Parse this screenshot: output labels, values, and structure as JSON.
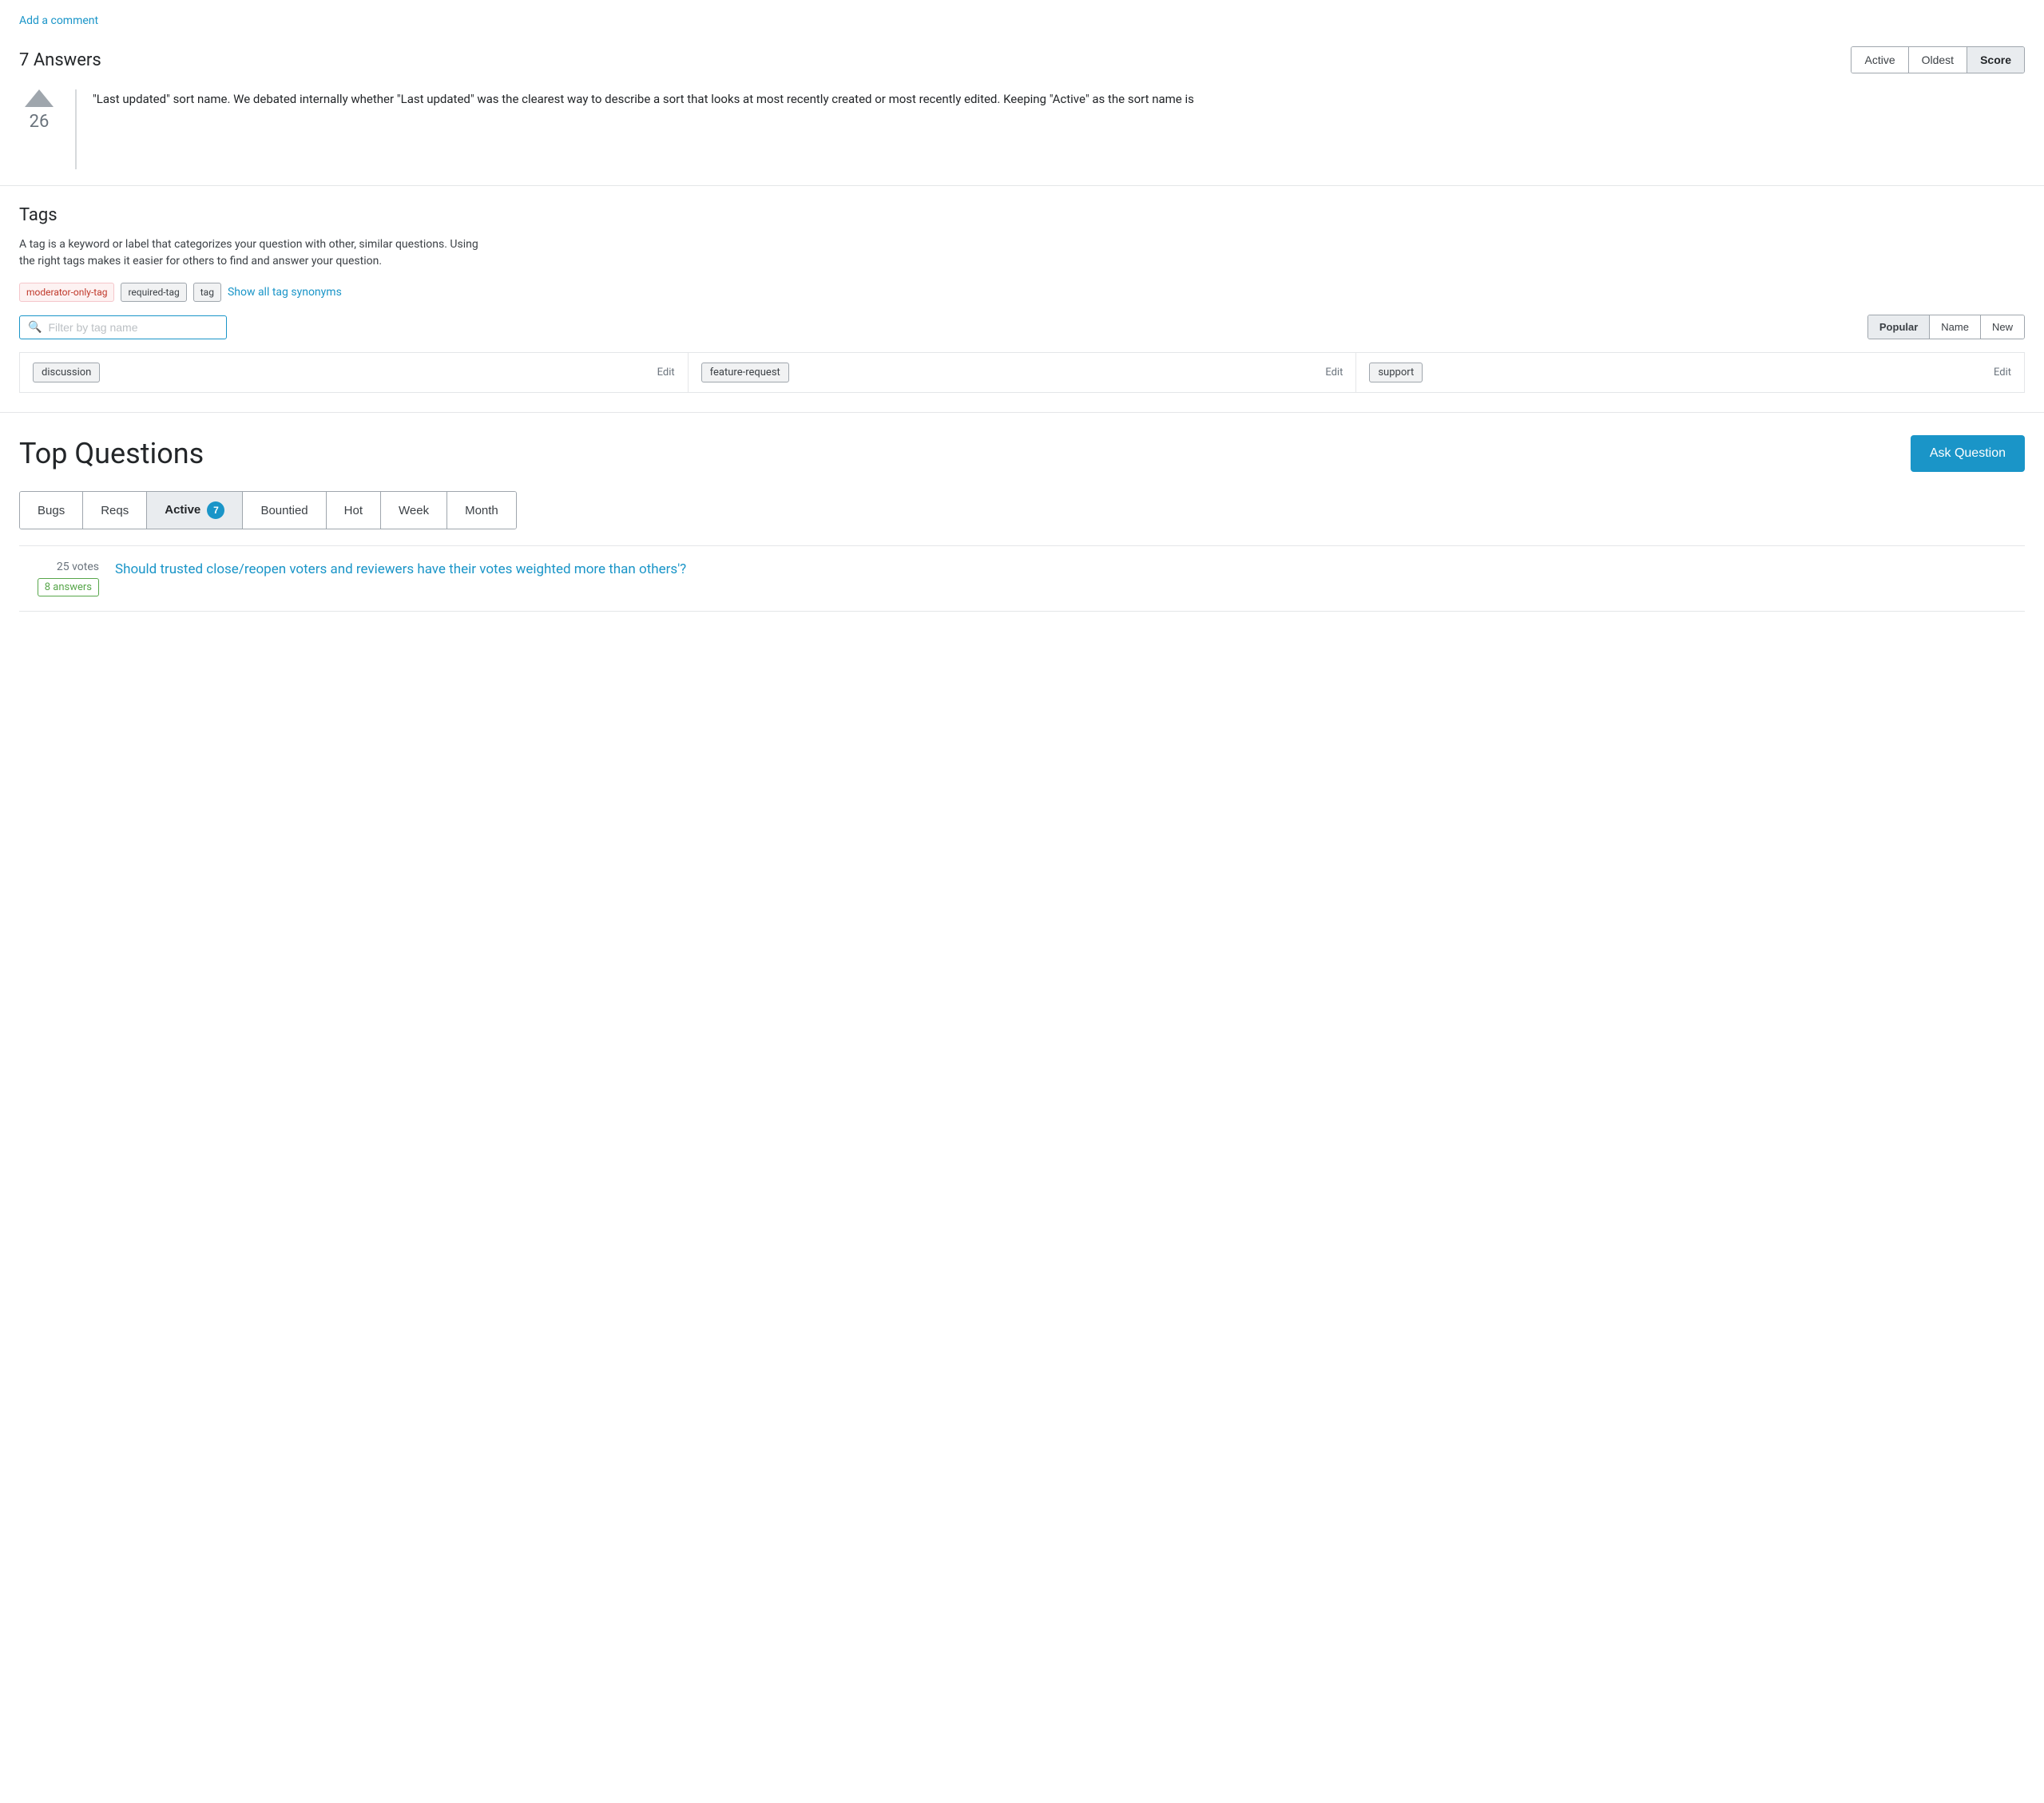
{
  "add_comment": {
    "link_text": "Add a comment"
  },
  "answers": {
    "title": "7 Answers",
    "sort_buttons": [
      {
        "label": "Active",
        "active": false
      },
      {
        "label": "Oldest",
        "active": false
      },
      {
        "label": "Score",
        "active": true
      }
    ],
    "vote_count": "26",
    "answer_text": "\"Last updated\" sort name. We debated internally whether \"Last updated\" was the clearest way to describe a sort that looks at most recently created or most recently edited. Keeping \"Active\" as the sort name is"
  },
  "tags": {
    "title": "Tags",
    "description_line1": "A tag is a keyword or label that categorizes your question with other, similar questions. Using",
    "description_line2": "the right tags makes it easier for others to find and answer your question.",
    "chips": [
      {
        "label": "moderator-only-tag",
        "style": "red"
      },
      {
        "label": "required-tag",
        "style": "gray"
      },
      {
        "label": "tag",
        "style": "gray"
      }
    ],
    "show_synonyms_text": "Show all tag synonyms",
    "search_placeholder": "Filter by tag name",
    "sort_buttons": [
      {
        "label": "Popular",
        "active": true
      },
      {
        "label": "Name",
        "active": false
      },
      {
        "label": "New",
        "active": false
      }
    ],
    "tag_list": [
      {
        "name": "discussion",
        "edit": "Edit"
      },
      {
        "name": "feature-request",
        "edit": "Edit"
      },
      {
        "name": "support",
        "edit": "Edit"
      }
    ]
  },
  "top_questions": {
    "title": "Top Questions",
    "ask_button": "Ask Question",
    "tabs": [
      {
        "label": "Bugs",
        "active": false
      },
      {
        "label": "Reqs",
        "active": false
      },
      {
        "label": "Active",
        "active": true,
        "badge": null
      },
      {
        "label": "7",
        "is_badge_tab": true,
        "badge_value": "7"
      },
      {
        "label": "Bountied",
        "active": false
      },
      {
        "label": "Hot",
        "active": false
      },
      {
        "label": "Week",
        "active": false
      },
      {
        "label": "Month",
        "active": false
      }
    ],
    "questions": [
      {
        "votes": "25 votes",
        "answers": "8 answers",
        "title": "Should trusted close/reopen voters and reviewers have their votes weighted more than others'?"
      }
    ]
  }
}
